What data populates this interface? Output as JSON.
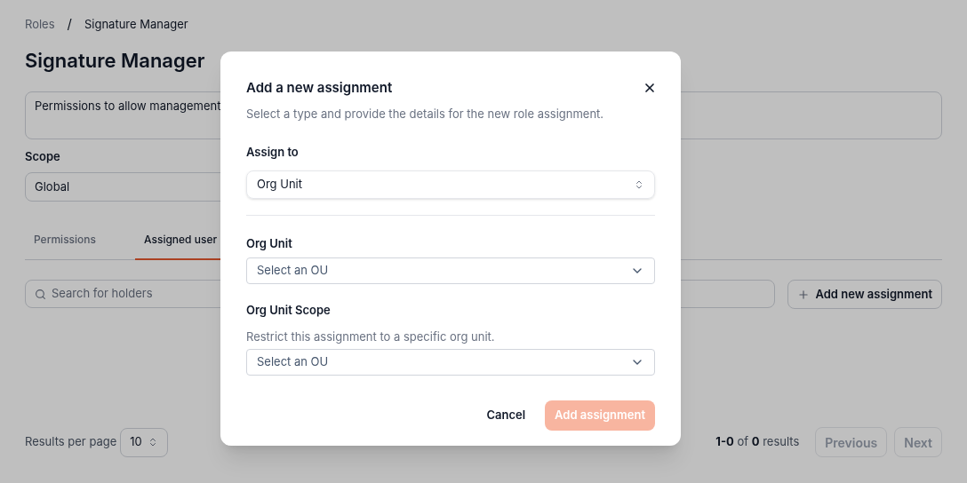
{
  "breadcrumb": {
    "items": [
      {
        "label": "Roles"
      },
      {
        "label": "Signature Manager"
      }
    ],
    "separator": "/"
  },
  "title": "Signature Manager",
  "description": "Permissions to allow management",
  "scope": {
    "label": "Scope",
    "value": "Global"
  },
  "tabs": [
    {
      "label": "Permissions",
      "selected": false
    },
    {
      "label": "Assigned user",
      "selected": true
    }
  ],
  "search": {
    "placeholder": "Search for holders"
  },
  "add_button": "Add new assignment",
  "pagination": {
    "page_size_label": "Results per page",
    "page_size": "10",
    "summary": "**1-0** of **0** results",
    "previous": {
      "label": "Previous",
      "disabled": true
    },
    "next": {
      "label": "Next",
      "disabled": true
    }
  },
  "dialog": {
    "title": "Add a new assignment",
    "subtitle": "Select a type and provide the details for the new role assignment.",
    "fields": [
      {
        "kind": "select",
        "label": "Assign to",
        "value": "Org Unit"
      },
      {
        "kind": "divider"
      },
      {
        "kind": "dropdown",
        "label": "Org Unit",
        "placeholder": "Select an OU"
      },
      {
        "kind": "dropdown",
        "label": "Org Unit Scope",
        "help": "Restrict this assignment to a specific org unit.",
        "placeholder": "Select an OU"
      }
    ],
    "cancel": "Cancel",
    "submit": {
      "label": "Add assignment",
      "disabled": true
    }
  }
}
